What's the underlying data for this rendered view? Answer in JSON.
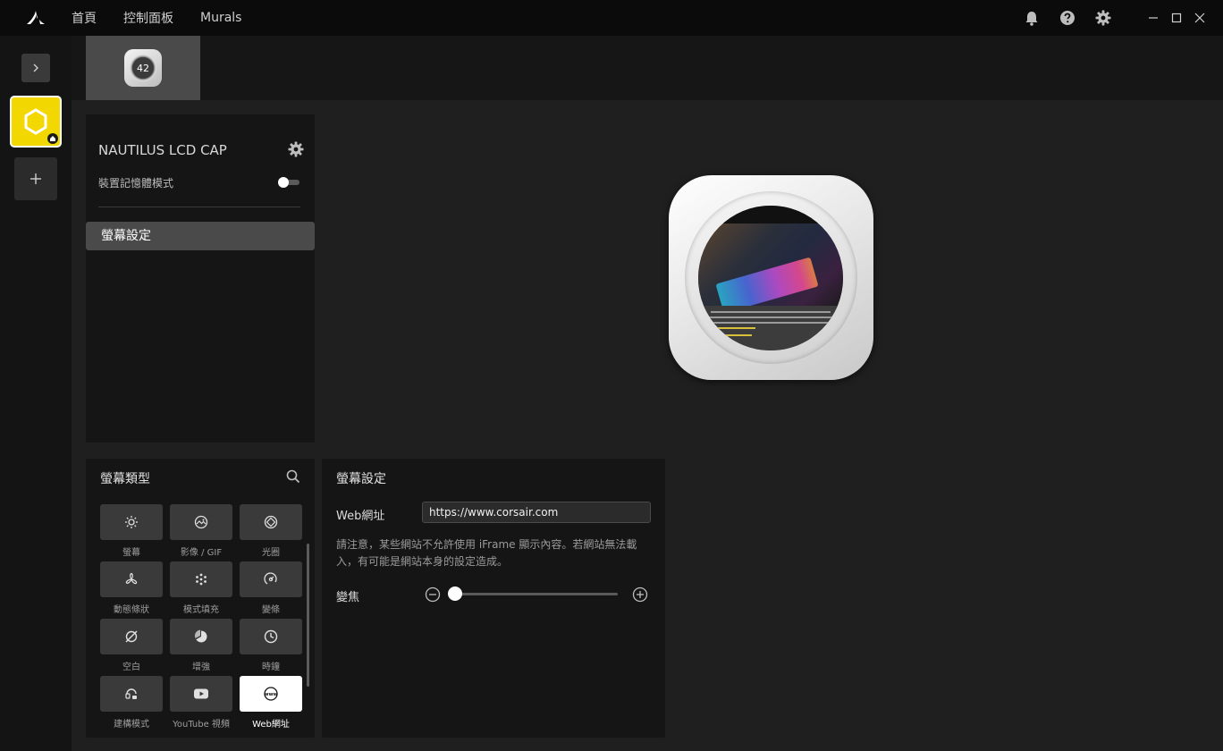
{
  "topbar": {
    "nav": [
      "首頁",
      "控制面板",
      "Murals"
    ],
    "icons": [
      "bell-icon",
      "help-icon",
      "gear-icon",
      "minimize-icon",
      "maximize-icon",
      "close-icon"
    ]
  },
  "device_tab": {
    "thumb_text": "42"
  },
  "device_panel": {
    "name": "NAUTILUS LCD CAP",
    "memory_mode_label": "裝置記憶體模式",
    "memory_mode_on": false,
    "menu": [
      "螢幕設定"
    ]
  },
  "screen_types": {
    "title": "螢幕類型",
    "selected": "Web網址",
    "items": [
      {
        "label": "螢幕",
        "icon": "sun-icon"
      },
      {
        "label": "影像 / GIF",
        "icon": "image-icon"
      },
      {
        "label": "光圈",
        "icon": "aperture-icon"
      },
      {
        "label": "動態條狀",
        "icon": "fan-icon"
      },
      {
        "label": "模式填充",
        "icon": "pattern-icon"
      },
      {
        "label": "變條",
        "icon": "gauge-icon"
      },
      {
        "label": "空白",
        "icon": "blank-icon"
      },
      {
        "label": "增強",
        "icon": "pie-icon"
      },
      {
        "label": "時鐘",
        "icon": "clock-icon"
      },
      {
        "label": "建構模式",
        "icon": "builder-icon"
      },
      {
        "label": "YouTube 視頻",
        "icon": "youtube-icon"
      },
      {
        "label": "Web網址",
        "icon": "www-icon"
      }
    ]
  },
  "screen_settings": {
    "title": "螢幕設定",
    "web_label": "Web網址",
    "web_value": "https://www.corsair.com",
    "notice": "請注意，某些網站不允許使用 iFrame 顯示內容。若網站無法載入，有可能是網站本身的設定造成。",
    "zoom_label": "變焦",
    "zoom_value": 0
  },
  "colors": {
    "accent_device": "#f2d700",
    "panel": "#151515",
    "background": "#1f1f1f"
  }
}
